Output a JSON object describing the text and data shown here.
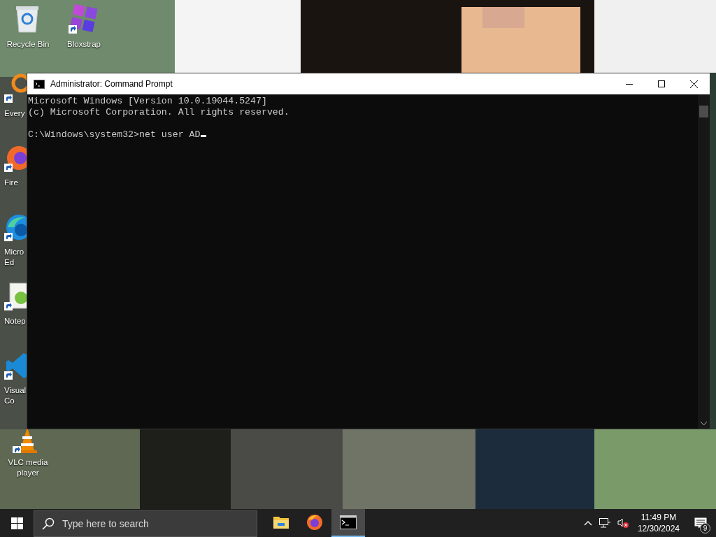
{
  "desktop": {
    "icons": [
      {
        "kind": "recycle-bin",
        "label_lines": [
          "Recycle Bin"
        ],
        "shortcut": false
      },
      {
        "kind": "bloxstrap",
        "label_lines": [
          "Bloxstrap"
        ],
        "shortcut": true
      },
      {
        "kind": "everything",
        "label_lines": [
          "Every"
        ],
        "shortcut": true
      },
      {
        "kind": "firefox",
        "label_lines": [
          "Fire"
        ],
        "shortcut": true
      },
      {
        "kind": "edge",
        "label_lines": [
          "Micro",
          "Ed"
        ],
        "shortcut": true
      },
      {
        "kind": "notepad",
        "label_lines": [
          "Notep"
        ],
        "shortcut": true
      },
      {
        "kind": "vscode",
        "label_lines": [
          "Visual",
          "Co"
        ],
        "shortcut": true
      },
      {
        "kind": "vlc",
        "label_lines": [
          "VLC media",
          "player"
        ],
        "shortcut": true
      }
    ]
  },
  "window": {
    "title": "Administrator: Command Prompt",
    "console": {
      "lines": [
        "Microsoft Windows [Version 10.0.19044.5247]",
        "(c) Microsoft Corporation. All rights reserved."
      ],
      "prompt": "C:\\Windows\\system32>",
      "input": "net user AD"
    }
  },
  "taskbar": {
    "search": {
      "placeholder": "Type here to search"
    },
    "apps": [
      {
        "kind": "file-explorer",
        "active": false
      },
      {
        "kind": "firefox",
        "active": false
      },
      {
        "kind": "command-prompt",
        "active": true
      }
    ],
    "clock": {
      "time": "11:49 PM",
      "date": "12/30/2024"
    },
    "notifications": {
      "count": "9"
    }
  }
}
